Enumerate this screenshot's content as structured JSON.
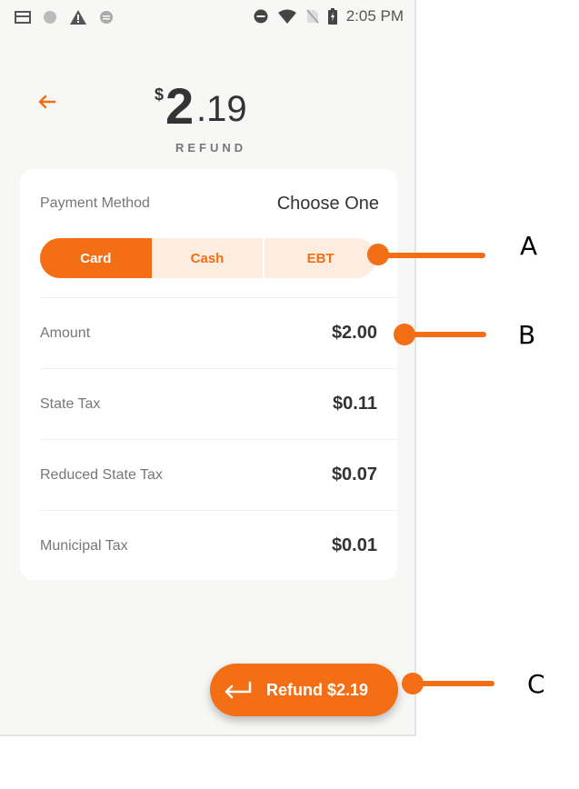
{
  "status_bar": {
    "time": "2:05 PM",
    "left_icons": [
      "card-icon",
      "circle-icon",
      "warning-icon",
      "sync-icon"
    ],
    "right_icons": [
      "do-not-disturb-icon",
      "wifi-icon",
      "no-sim-icon",
      "battery-charging-icon"
    ]
  },
  "header": {
    "currency_symbol": "$",
    "amount_int": "2",
    "amount_dec": ".19",
    "subtitle": "REFUND"
  },
  "payment": {
    "label": "Payment Method",
    "value": "Choose One",
    "options": [
      {
        "label": "Card",
        "active": true
      },
      {
        "label": "Cash",
        "active": false
      },
      {
        "label": "EBT",
        "active": false
      }
    ]
  },
  "lines": [
    {
      "label": "Amount",
      "value": "$2.00"
    },
    {
      "label": "State Tax",
      "value": "$0.11"
    },
    {
      "label": "Reduced State Tax",
      "value": "$0.07"
    },
    {
      "label": "Municipal Tax",
      "value": "$0.01"
    }
  ],
  "action": {
    "refund_label": "Refund $2.19"
  },
  "callouts": [
    "A",
    "B",
    "C"
  ],
  "colors": {
    "accent": "#f36e14",
    "accent_light": "#fdece0",
    "text_primary": "#333333",
    "text_secondary": "#777777"
  }
}
